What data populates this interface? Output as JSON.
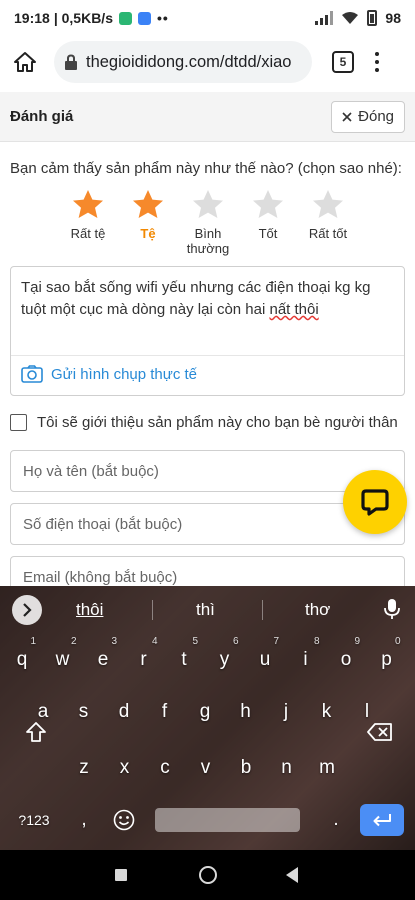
{
  "status_bar": {
    "time": "19:18",
    "speed": "| 0,5KB/s",
    "dots": "••",
    "battery": "98"
  },
  "browser": {
    "url": "thegioididong.com/dtdd/xiao",
    "tab_count": "5"
  },
  "header": {
    "title": "Đánh giá",
    "close_label": "Đóng"
  },
  "question": "Bạn cảm thấy sản phẩm này như thế nào? (chọn sao nhé):",
  "rating": {
    "selected": 2,
    "active_color": "#f28902",
    "filled_color": "#f6892b",
    "empty_color": "#dddddd",
    "stars": [
      {
        "label": "Rất tệ"
      },
      {
        "label": "Tệ"
      },
      {
        "label": "Bình thường"
      },
      {
        "label": "Tốt"
      },
      {
        "label": "Rất tốt"
      }
    ]
  },
  "review": {
    "text_main": "Tại sao bắt sống wifi yếu nhưng các điện thoại kg kg tuột một cục mà dòng này lại còn hai ",
    "text_tail": "nất thôi",
    "upload_label": "Gửi hình chụp thực tế",
    "upload_icon": "camera-icon"
  },
  "recommend_label": "Tôi sẽ giới thiệu sản phẩm này cho bạn bè người thân",
  "fields": {
    "name_placeholder": "Họ và tên (bắt buộc)",
    "phone_placeholder": "Số điện thoại (bắt buộc)",
    "email_placeholder": "Email (không bắt buộc)"
  },
  "keyboard": {
    "suggestions": [
      "thôi",
      "thì",
      "thơ"
    ],
    "row1": [
      {
        "k": "q",
        "n": "1"
      },
      {
        "k": "w",
        "n": "2"
      },
      {
        "k": "e",
        "n": "3"
      },
      {
        "k": "r",
        "n": "4"
      },
      {
        "k": "t",
        "n": "5"
      },
      {
        "k": "y",
        "n": "6"
      },
      {
        "k": "u",
        "n": "7"
      },
      {
        "k": "i",
        "n": "8"
      },
      {
        "k": "o",
        "n": "9"
      },
      {
        "k": "p",
        "n": "0"
      }
    ],
    "row2": [
      "a",
      "s",
      "d",
      "f",
      "g",
      "h",
      "j",
      "k",
      "l"
    ],
    "row3": [
      "z",
      "x",
      "c",
      "v",
      "b",
      "n",
      "m"
    ],
    "symbols_label": "?123",
    "comma": ",",
    "period": ".",
    "enter_color": "#4b8ef5"
  }
}
